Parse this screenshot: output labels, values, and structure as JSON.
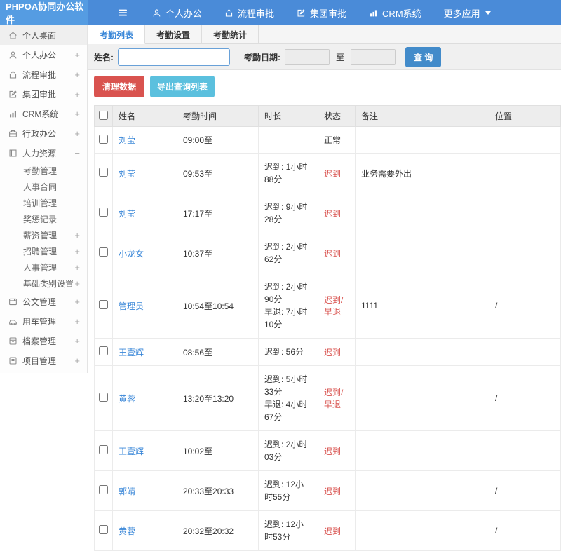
{
  "colors": {
    "header-blue": "#4a8bd8",
    "logo-blue": "#559ce2",
    "link-blue": "#3a87d8",
    "primary-blue": "#428bca",
    "danger-red": "#d9534f",
    "info-cyan": "#5bc0de"
  },
  "header": {
    "logo": "PHPOA协同办公软件",
    "nav": [
      {
        "label": "个人办公",
        "icon": "person-icon"
      },
      {
        "label": "流程审批",
        "icon": "share-icon"
      },
      {
        "label": "集团审批",
        "icon": "edit-icon"
      },
      {
        "label": "CRM系统",
        "icon": "chart-icon"
      },
      {
        "label": "更多应用",
        "icon": "caret-down-icon",
        "icon_after": true
      }
    ]
  },
  "sidebar": {
    "items": [
      {
        "label": "个人桌面",
        "icon": "home-icon",
        "active": true
      },
      {
        "label": "个人办公",
        "icon": "person-icon",
        "expandable": true
      },
      {
        "label": "流程审批",
        "icon": "share-icon",
        "expandable": true
      },
      {
        "label": "集团审批",
        "icon": "edit-icon",
        "expandable": true
      },
      {
        "label": "CRM系统",
        "icon": "chart-icon",
        "expandable": true
      },
      {
        "label": "行政办公",
        "icon": "briefcase-icon",
        "expandable": true
      },
      {
        "label": "人力资源",
        "icon": "book-icon",
        "expanded": true,
        "children": [
          {
            "label": "考勤管理"
          },
          {
            "label": "人事合同"
          },
          {
            "label": "培训管理"
          },
          {
            "label": "奖惩记录"
          },
          {
            "label": "薪资管理",
            "expandable": true
          },
          {
            "label": "招聘管理",
            "expandable": true
          },
          {
            "label": "人事管理",
            "expandable": true
          },
          {
            "label": "基础类别设置",
            "expandable": true
          }
        ]
      },
      {
        "label": "公文管理",
        "icon": "document-icon",
        "expandable": true
      },
      {
        "label": "用车管理",
        "icon": "car-icon",
        "expandable": true
      },
      {
        "label": "档案管理",
        "icon": "archive-icon",
        "expandable": true
      },
      {
        "label": "项目管理",
        "icon": "project-icon",
        "expandable": true
      }
    ],
    "expand_glyph": "+",
    "collapse_glyph": "−"
  },
  "tabs": [
    {
      "label": "考勤列表",
      "active": true
    },
    {
      "label": "考勤设置",
      "active": false
    },
    {
      "label": "考勤统计",
      "active": false
    }
  ],
  "filter": {
    "name_label": "姓名:",
    "name_value": "",
    "date_label": "考勤日期:",
    "date_from_value": "",
    "to_label": "至",
    "date_to_value": "",
    "search_button": "查 询"
  },
  "actions": {
    "clean_button": "清理数据",
    "export_button": "导出查询列表"
  },
  "table": {
    "columns": [
      "姓名",
      "考勤时间",
      "时长",
      "状态",
      "备注",
      "位置"
    ],
    "rows": [
      {
        "name": "刘莹",
        "time": "09:00至",
        "duration": "",
        "status": "正常",
        "alert": false,
        "remark": "",
        "location": ""
      },
      {
        "name": "刘莹",
        "time": "09:53至",
        "duration": "迟到: 1小时88分",
        "status": "迟到",
        "alert": true,
        "remark": "业务需要外出",
        "location": ""
      },
      {
        "name": "刘莹",
        "time": "17:17至",
        "duration": "迟到: 9小时28分",
        "status": "迟到",
        "alert": true,
        "remark": "",
        "location": ""
      },
      {
        "name": "小龙女",
        "time": "10:37至",
        "duration": "迟到: 2小时62分",
        "status": "迟到",
        "alert": true,
        "remark": "",
        "location": ""
      },
      {
        "name": "管理员",
        "time": "10:54至10:54",
        "duration": "迟到: 2小时90分\n早退: 7小时10分",
        "status": "迟到/早退",
        "alert": true,
        "remark": "1111",
        "location": "/"
      },
      {
        "name": "王壹辉",
        "time": "08:56至",
        "duration": "迟到: 56分",
        "status": "迟到",
        "alert": true,
        "remark": "",
        "location": ""
      },
      {
        "name": "黄蓉",
        "time": "13:20至13:20",
        "duration": "迟到: 5小时33分\n早退: 4小时67分",
        "status": "迟到/早退",
        "alert": true,
        "remark": "",
        "location": "/"
      },
      {
        "name": "王壹辉",
        "time": "10:02至",
        "duration": "迟到: 2小时03分",
        "status": "迟到",
        "alert": true,
        "remark": "",
        "location": ""
      },
      {
        "name": "郭靖",
        "time": "20:33至20:33",
        "duration": "迟到: 12小时55分",
        "status": "迟到",
        "alert": true,
        "remark": "",
        "location": "/"
      },
      {
        "name": "黄蓉",
        "time": "20:32至20:32",
        "duration": "迟到: 12小时53分",
        "status": "迟到",
        "alert": true,
        "remark": "",
        "location": "/"
      }
    ]
  }
}
